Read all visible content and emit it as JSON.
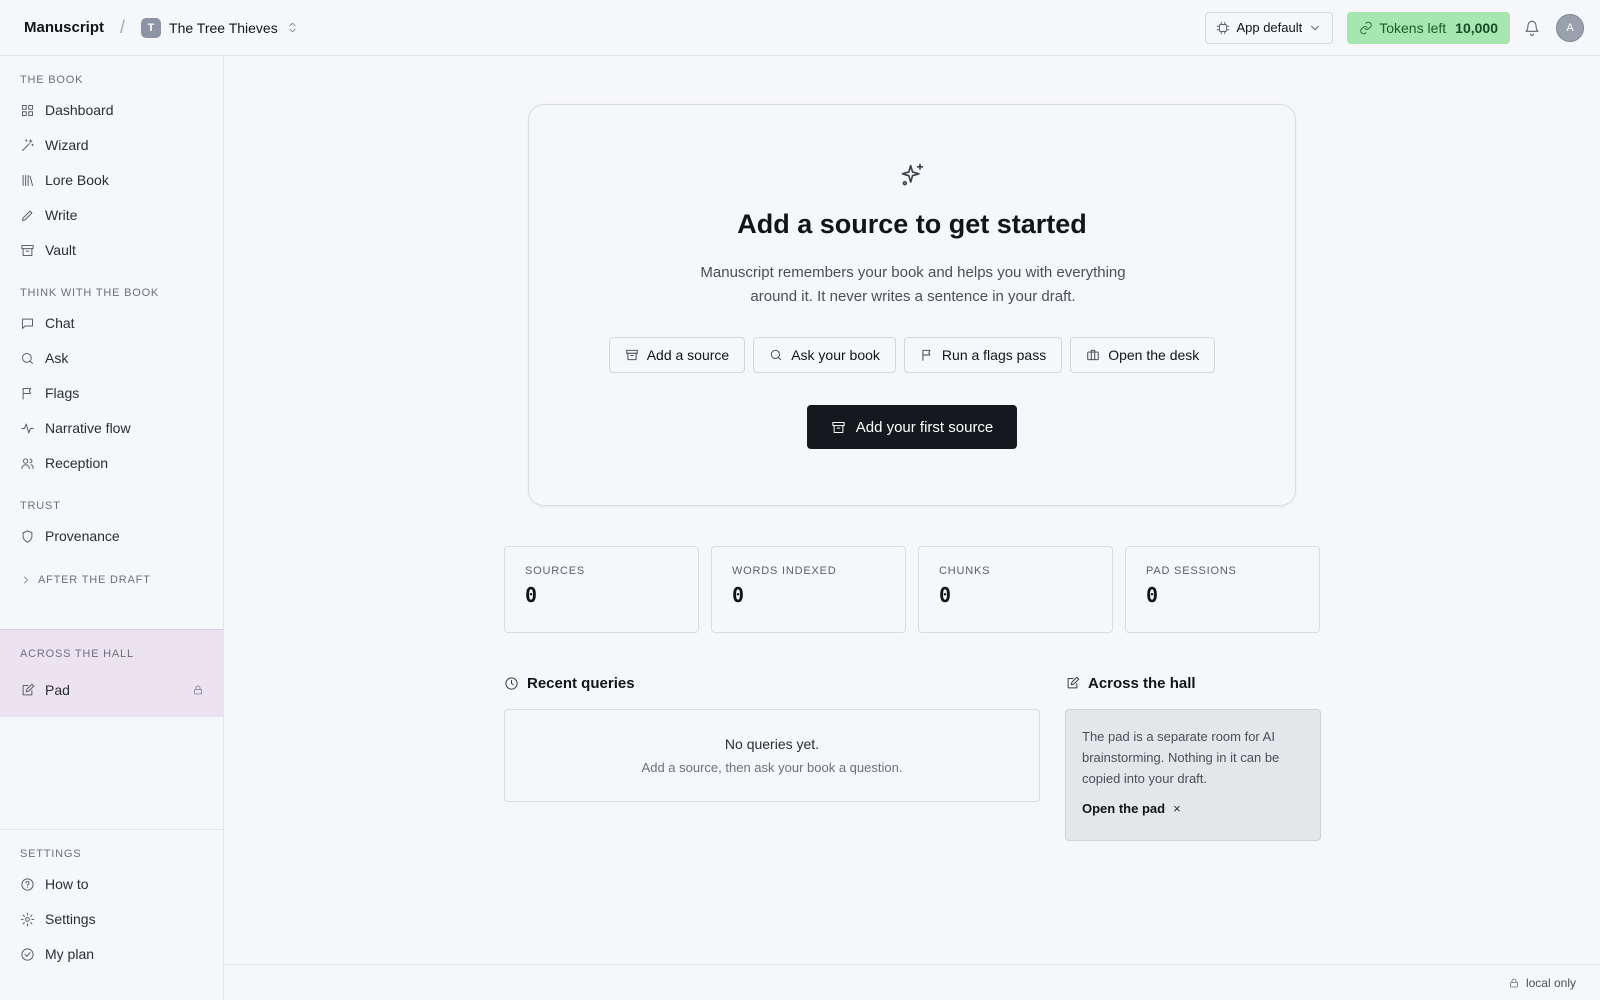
{
  "topbar": {
    "brand": "Manuscript",
    "separator": "/",
    "project_initial": "T",
    "project_name": "The Tree Thieves",
    "model_label": "App default",
    "tokens_label": "Tokens left",
    "tokens_value": "10,000",
    "user_initial": "A"
  },
  "sidebar": {
    "section_book": "THE BOOK",
    "book_items": [
      "Dashboard",
      "Wizard",
      "Lore Book",
      "Write",
      "Vault"
    ],
    "section_think": "THINK WITH THE BOOK",
    "think_items": [
      "Chat",
      "Ask",
      "Flags",
      "Narrative flow",
      "Reception"
    ],
    "section_trust": "TRUST",
    "trust_items": [
      "Provenance"
    ],
    "collapsed_section": "AFTER THE DRAFT",
    "section_hall": "ACROSS THE HALL",
    "hall_items": [
      "Pad"
    ],
    "section_settings": "SETTINGS",
    "settings_items": [
      "How to",
      "Settings",
      "My plan"
    ]
  },
  "hero": {
    "title": "Add a source to get started",
    "subtitle": "Manuscript remembers your book and helps you with everything around it. It never writes a sentence in your draft.",
    "actions": [
      "Add a source",
      "Ask your book",
      "Run a flags pass",
      "Open the desk"
    ],
    "primary": "Add your first source"
  },
  "stats": [
    {
      "label": "SOURCES",
      "value": "0"
    },
    {
      "label": "WORDS INDEXED",
      "value": "0"
    },
    {
      "label": "CHUNKS",
      "value": "0"
    },
    {
      "label": "PAD SESSIONS",
      "value": "0"
    }
  ],
  "recent": {
    "title": "Recent queries",
    "empty": "No queries yet.",
    "hint": "Add a source, then ask your book a question."
  },
  "hall_panel": {
    "title": "Across the hall",
    "text": "The pad is a separate room for AI brainstorming. Nothing in it can be copied into your draft.",
    "link": "Open the pad",
    "close": "×"
  },
  "footer": {
    "status": "local only"
  },
  "colors": {
    "tokens_bg": "#a5e6b1",
    "primary_bg": "#15181d",
    "hall_bg": "#ece3f2"
  }
}
